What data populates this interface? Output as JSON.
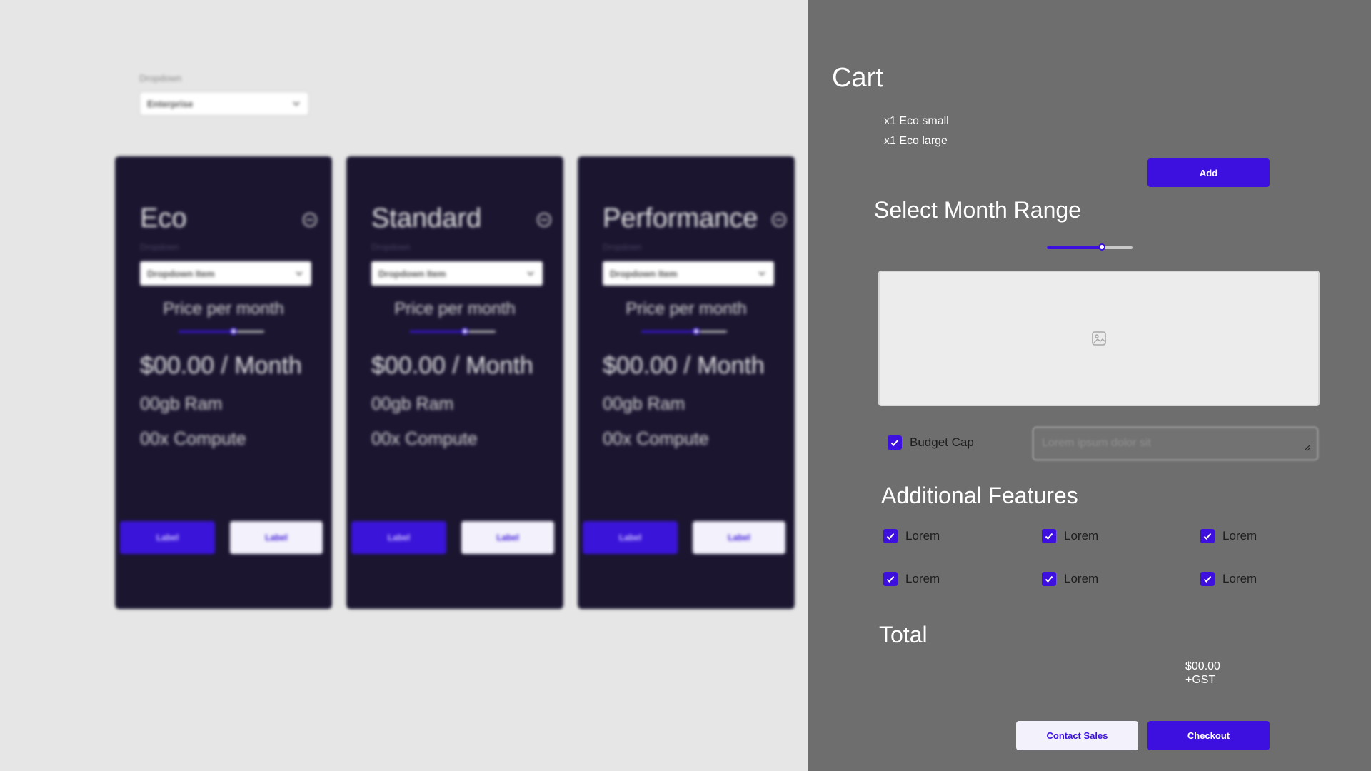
{
  "background": {
    "top_dropdown": {
      "label": "Dropdown",
      "value": "Enterprise"
    },
    "cards": [
      {
        "title": "Eco",
        "dropdown_label": "Dropdown",
        "dropdown_value": "Dropdown Item",
        "price_label": "Price per month",
        "price": "$00.00 / Month",
        "ram": "00gb Ram",
        "compute": "00x Compute",
        "button_primary": "Label",
        "button_secondary": "Label",
        "slider_value": 0.64
      },
      {
        "title": "Standard",
        "dropdown_label": "Dropdown",
        "dropdown_value": "Dropdown Item",
        "price_label": "Price per month",
        "price": "$00.00 / Month",
        "ram": "00gb Ram",
        "compute": "00x Compute",
        "button_primary": "Label",
        "button_secondary": "Label",
        "slider_value": 0.64
      },
      {
        "title": "Performance",
        "dropdown_label": "Dropdown",
        "dropdown_value": "Dropdown Item",
        "price_label": "Price per month",
        "price": "$00.00 / Month",
        "ram": "00gb Ram",
        "compute": "00x Compute",
        "button_primary": "Label",
        "button_secondary": "Label",
        "slider_value": 0.64
      }
    ]
  },
  "cart": {
    "title": "Cart",
    "items": [
      "x1 Eco small",
      "x1 Eco large"
    ],
    "add_label": "Add",
    "month_range": {
      "heading": "Select Month Range",
      "slider_value": 0.64
    },
    "image_icon": "image-icon",
    "budget": {
      "label": "Budget Cap",
      "checked": true,
      "placeholder": "Lorem ipsum dolor sit"
    },
    "features": {
      "heading": "Additional Features",
      "items": [
        "Lorem",
        "Lorem",
        "Lorem",
        "Lorem",
        "Lorem",
        "Lorem"
      ]
    },
    "total": {
      "heading": "Total",
      "amount": "$00.00",
      "tax": "+GST"
    },
    "contact_label": "Contact Sales",
    "checkout_label": "Checkout"
  },
  "colors": {
    "accent": "#3d10e0",
    "card_bg": "#1b1530",
    "panel_bg": "#6e6e6e",
    "page_bg": "#e6e6e6"
  }
}
